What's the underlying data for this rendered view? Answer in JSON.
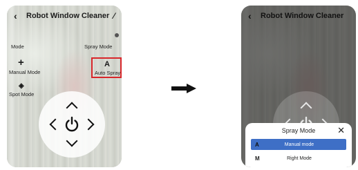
{
  "left_screen": {
    "header": {
      "back_icon": "chevron-left-icon",
      "title": "Robot Window Cleaner",
      "edit_icon": "pencil-icon"
    },
    "mode": {
      "label": "Mode",
      "current_icon": "plus-icon",
      "current_label": "Manual Mode",
      "secondary_icon": "diamond-target-icon",
      "secondary_label": "Spot Mode"
    },
    "spray": {
      "label": "Spray Mode",
      "current_glyph": "A",
      "current_label": "Auto Spray"
    },
    "highlight_color": "#d8262a"
  },
  "transition_arrow_icon": "right-arrow-icon",
  "right_screen": {
    "header": {
      "title": "Robot Window Cleaner"
    },
    "sheet": {
      "title": "Spray Mode",
      "close_icon": "close-icon",
      "options": [
        {
          "key": "A",
          "label": "Manual mode",
          "selected": true
        },
        {
          "key": "M",
          "label": "Right Mode",
          "selected": false
        }
      ],
      "selected_color": "#3e6fc6"
    }
  }
}
